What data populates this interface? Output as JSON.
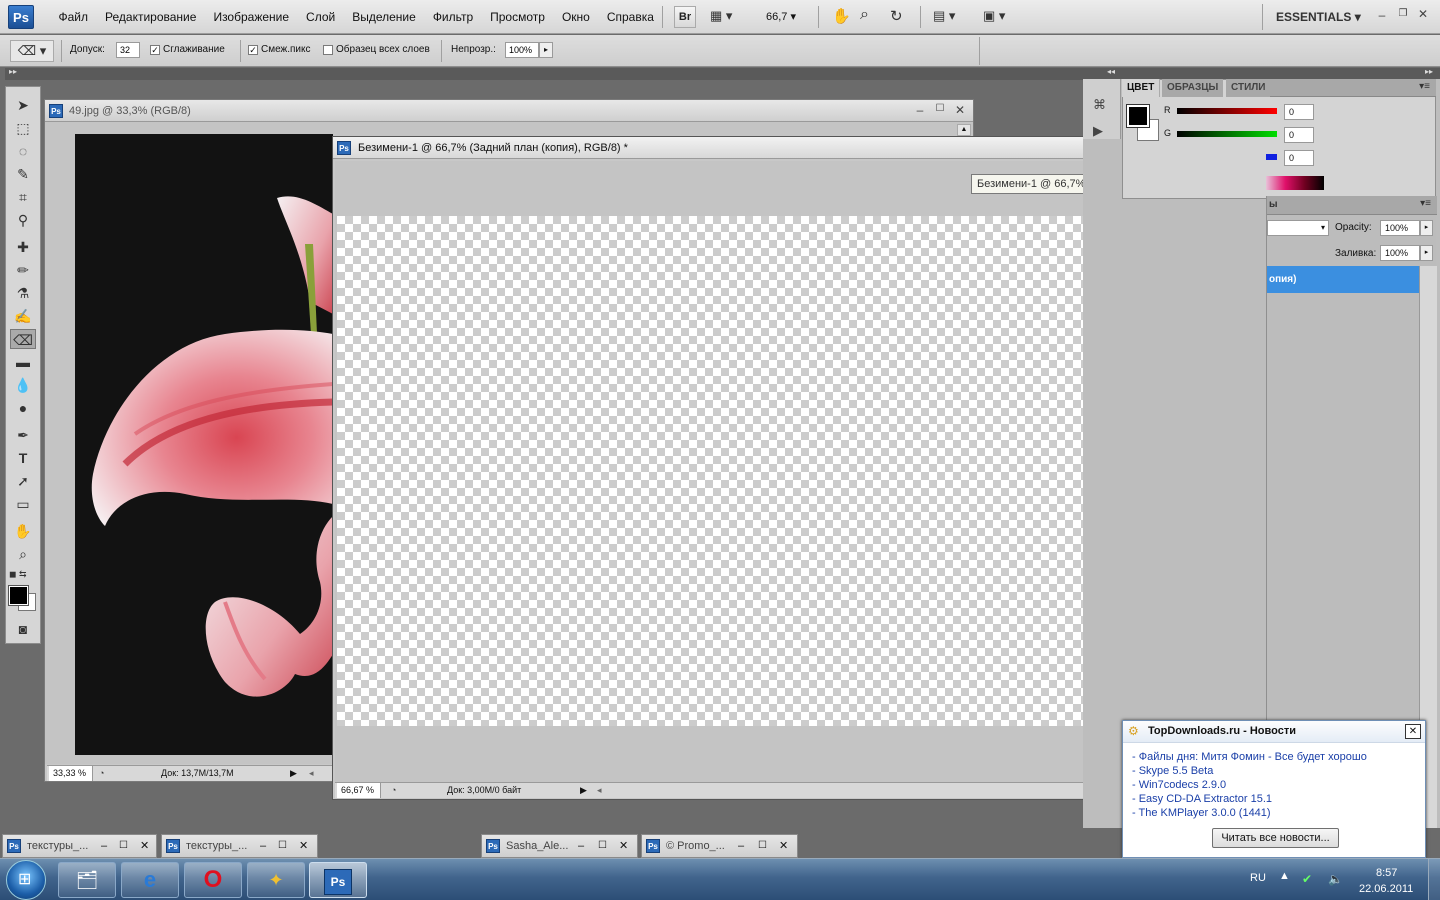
{
  "app": {
    "logo": "Ps"
  },
  "menu": [
    "Файл",
    "Редактирование",
    "Изображение",
    "Слой",
    "Выделение",
    "Фильтр",
    "Просмотр",
    "Окно",
    "Справка"
  ],
  "menubar_right": {
    "bridge": "Br",
    "zoom": "66,7",
    "workspace": "ESSENTIALS"
  },
  "options": {
    "tolerance_label": "Допуск:",
    "tolerance_value": "32",
    "antialias_label": "Сглаживание",
    "contiguous_label": "Смеж.пикс",
    "all_layers_label": "Образец всех слоев",
    "opacity_label": "Непрозр.:",
    "opacity_value": "100%"
  },
  "doc1": {
    "title": "49.jpg @ 33,3% (RGB/8)",
    "zoom": "33,33 %",
    "doc_size": "Док: 13,7M/13,7M"
  },
  "doc2": {
    "title": "Безимени-1 @ 66,7% (Задний план (копия), RGB/8) *",
    "tooltip": "Безимени-1 @ 66,7% (Задний план (копия), RGB/8) *",
    "zoom": "66,67 %",
    "doc_size": "Док: 3,00M/0 байт"
  },
  "color_panel": {
    "tabs": [
      "ЦВЕТ",
      "ОБРАЗЦЫ",
      "СТИЛИ"
    ],
    "r_label": "R",
    "g_label": "G",
    "r_value": "0",
    "g_value": "0",
    "b_value": "0"
  },
  "layers_panel": {
    "tab_fragment": "ы",
    "opacity_label": "Opacity:",
    "opacity_value": "100%",
    "fill_label": "Заливка:",
    "fill_value": "100%",
    "layer_fragment": "опия)"
  },
  "minimized": [
    {
      "title": "текстуры_..."
    },
    {
      "title": "текстуры_..."
    },
    {
      "title": "Sasha_Ale..."
    },
    {
      "title": "© Promo_..."
    }
  ],
  "popup": {
    "title": "TopDownloads.ru - Новости",
    "items": [
      "- Файлы дня: Митя Фомин - Все будет хорошо",
      "- Skype 5.5 Beta",
      "- Win7codecs 2.9.0",
      "- Easy CD-DA Extractor 15.1",
      "- The KMPlayer 3.0.0 (1441)"
    ],
    "button": "Читать все новости..."
  },
  "taskbar": {
    "lang": "RU",
    "time": "8:57",
    "date": "22.06.2011",
    "ps_label": "Ps"
  }
}
